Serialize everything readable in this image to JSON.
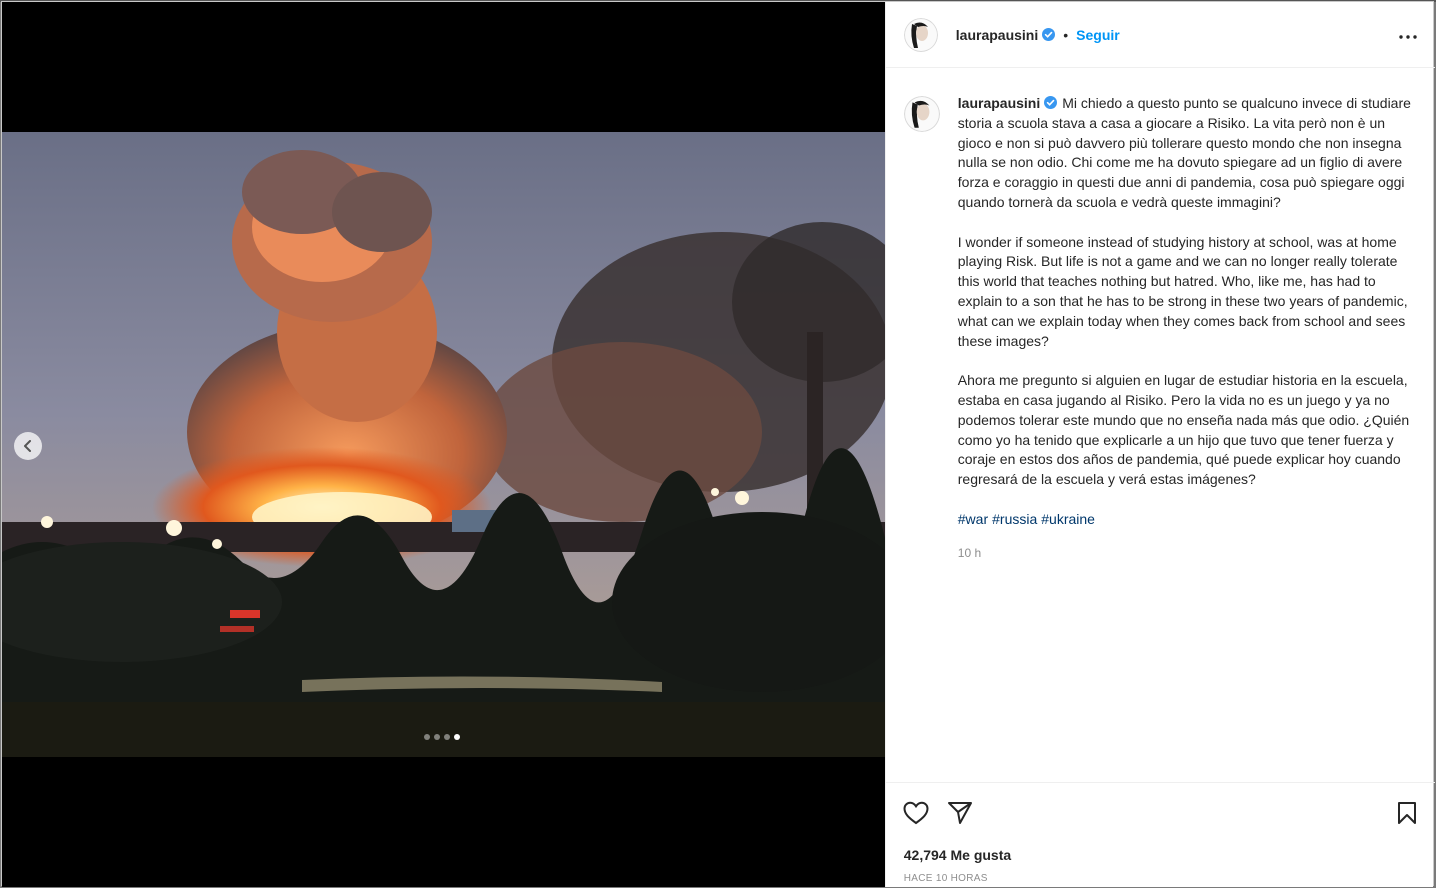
{
  "post": {
    "username": "laurapausini",
    "follow_label": "Seguir",
    "separator": "•",
    "caption_paragraphs": [
      "Mi chiedo a questo punto se qualcuno invece di studiare storia a scuola stava a casa a giocare a Risiko. La vita però non è un gioco e non si può davvero più tollerare questo mondo che non insegna nulla se non odio. Chi come me ha dovuto spiegare ad un figlio di avere forza e coraggio in questi due anni di pandemia, cosa può spiegare oggi quando tornerà da scuola e vedrà queste immagini?",
      "I wonder if someone instead of studying history at school, was at home playing Risk. But life is not a game and we can no longer really tolerate this world that teaches nothing but hatred. Who, like me, has had to explain to a son that he has to be strong in these two years of pandemic, what can we explain today when they comes back from school and sees these images?",
      "Ahora me pregunto si alguien en lugar de estudiar historia en la escuela, estaba en casa jugando al Risiko. Pero la vida no es un juego y ya no podemos tolerar este mundo que no enseña nada más que odio. ¿Quién como yo ha tenido que explicarle a un hijo que tuvo que tener fuerza y coraje en estos dos años de pandemia, qué puede explicar hoy cuando regresará de la escuela y verá estas imágenes?"
    ],
    "hashtags": [
      "#war",
      "#russia",
      "#ukraine"
    ],
    "comment_time": "10 h",
    "likes_label": "42,794 Me gusta",
    "post_time": "HACE 10 HORAS"
  },
  "carousel": {
    "dot_count": 4,
    "active_index": 3
  },
  "icons": {
    "verified": "verified-badge-icon",
    "more": "more-options-icon",
    "prev": "chevron-left-icon",
    "like": "heart-icon",
    "share": "paper-plane-icon",
    "save": "bookmark-icon"
  },
  "colors": {
    "accent": "#0095f6",
    "hashtag": "#00376b",
    "muted": "#8e8e8e",
    "text": "#262626"
  }
}
